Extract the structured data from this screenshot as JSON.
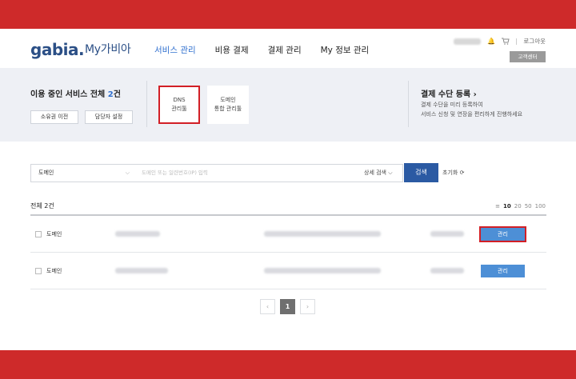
{
  "brand": {
    "logo": "gabia.",
    "sub": "My가비아"
  },
  "nav": [
    "서비스 관리",
    "비용 결제",
    "결제 관리",
    "My 정보 관리"
  ],
  "util": {
    "logout": "로그아웃",
    "customer_center": "고객센터"
  },
  "summary": {
    "title_prefix": "이용 중인 서비스 전체 ",
    "count": "2",
    "title_suffix": "건",
    "transfer_btn": "소유권 이전",
    "manager_btn": "담당자 설정"
  },
  "quick": {
    "dns_line1": "DNS",
    "dns_line2": "관리툴",
    "domain_line1": "도메인",
    "domain_line2": "통합 관리툴"
  },
  "payment": {
    "title": "결제 수단 등록 ›",
    "desc1": "결제 수단을 미리 등록하여",
    "desc2": "서비스 신청 및 연장을 편리하게 진행하세요"
  },
  "search": {
    "category": "도메인",
    "placeholder": "도메인 또는 일련번호(IP) 입력",
    "advanced": "상세 검색 ⌵",
    "button": "검색",
    "reset": "초기화"
  },
  "list": {
    "total": "전체 2건",
    "page_sizes": [
      "10",
      "20",
      "50",
      "100"
    ],
    "selected_size": "10",
    "rows": [
      {
        "type": "도메인",
        "action": "관리"
      },
      {
        "type": "도메인",
        "action": "관리"
      }
    ]
  },
  "pager": {
    "prev": "‹",
    "current": "1",
    "next": "›"
  },
  "colors": {
    "band": "#ce2a2a",
    "accent": "#2f6fcf",
    "button": "#4d8fd6",
    "highlight": "#d21f26"
  }
}
